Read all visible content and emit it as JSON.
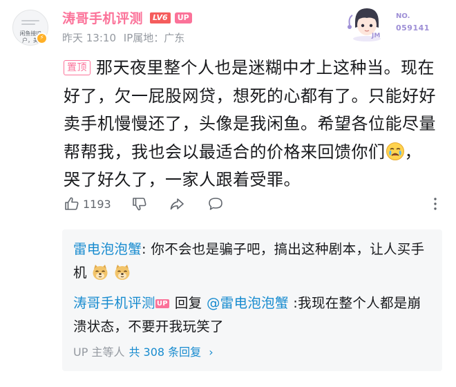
{
  "user": {
    "name": "涛哥手机评测",
    "level_badge": "LV6",
    "up_badge": "UP",
    "avatar_text_1": "闲鱼接IP",
    "avatar_text_2": "户，美",
    "time": "昨天 13:10",
    "ip_location": "IP属地：广东"
  },
  "decoration": {
    "no_label": "NO.",
    "number": "059141",
    "initials": "JM"
  },
  "comment": {
    "pin_label": "置顶",
    "text_before_emoji": "那天夜里整个人也是迷糊中才上这种当。现在好了，欠一屁股网贷，想死的心都有了。只能好好卖手机慢慢还了，头像是我闲鱼。希望各位能尽量帮帮我，我也会以最适合的价格来回馈你们",
    "emoji": "crying-face-emoji",
    "text_after_emoji": "，哭了好久了，一家人跟着受罪。"
  },
  "actions": {
    "like_count": "1193",
    "icons": [
      "thumbs-up-icon",
      "thumbs-down-icon",
      "share-icon",
      "comment-icon",
      "more-icon"
    ]
  },
  "replies": [
    {
      "name": "雷电泡泡蟹",
      "separator": ": ",
      "text": "你不会也是骗子吧，搞出这种剧本，让人买手机"
    },
    {
      "name": "涛哥手机评测",
      "up_badge": "UP",
      "reply_word": "回复 ",
      "mention": "@雷电泡泡蟹",
      "text": " :我现在整个人都是崩溃状态，不要开我玩笑了"
    }
  ],
  "more_replies": {
    "prefix": "UP 主等人",
    "link": "共 308 条回复",
    "chevron": "›"
  },
  "colors": {
    "pink": "#fb7299",
    "blue": "#178bcf",
    "gray": "#9499a0",
    "reply_bg": "#f6f7f8"
  }
}
